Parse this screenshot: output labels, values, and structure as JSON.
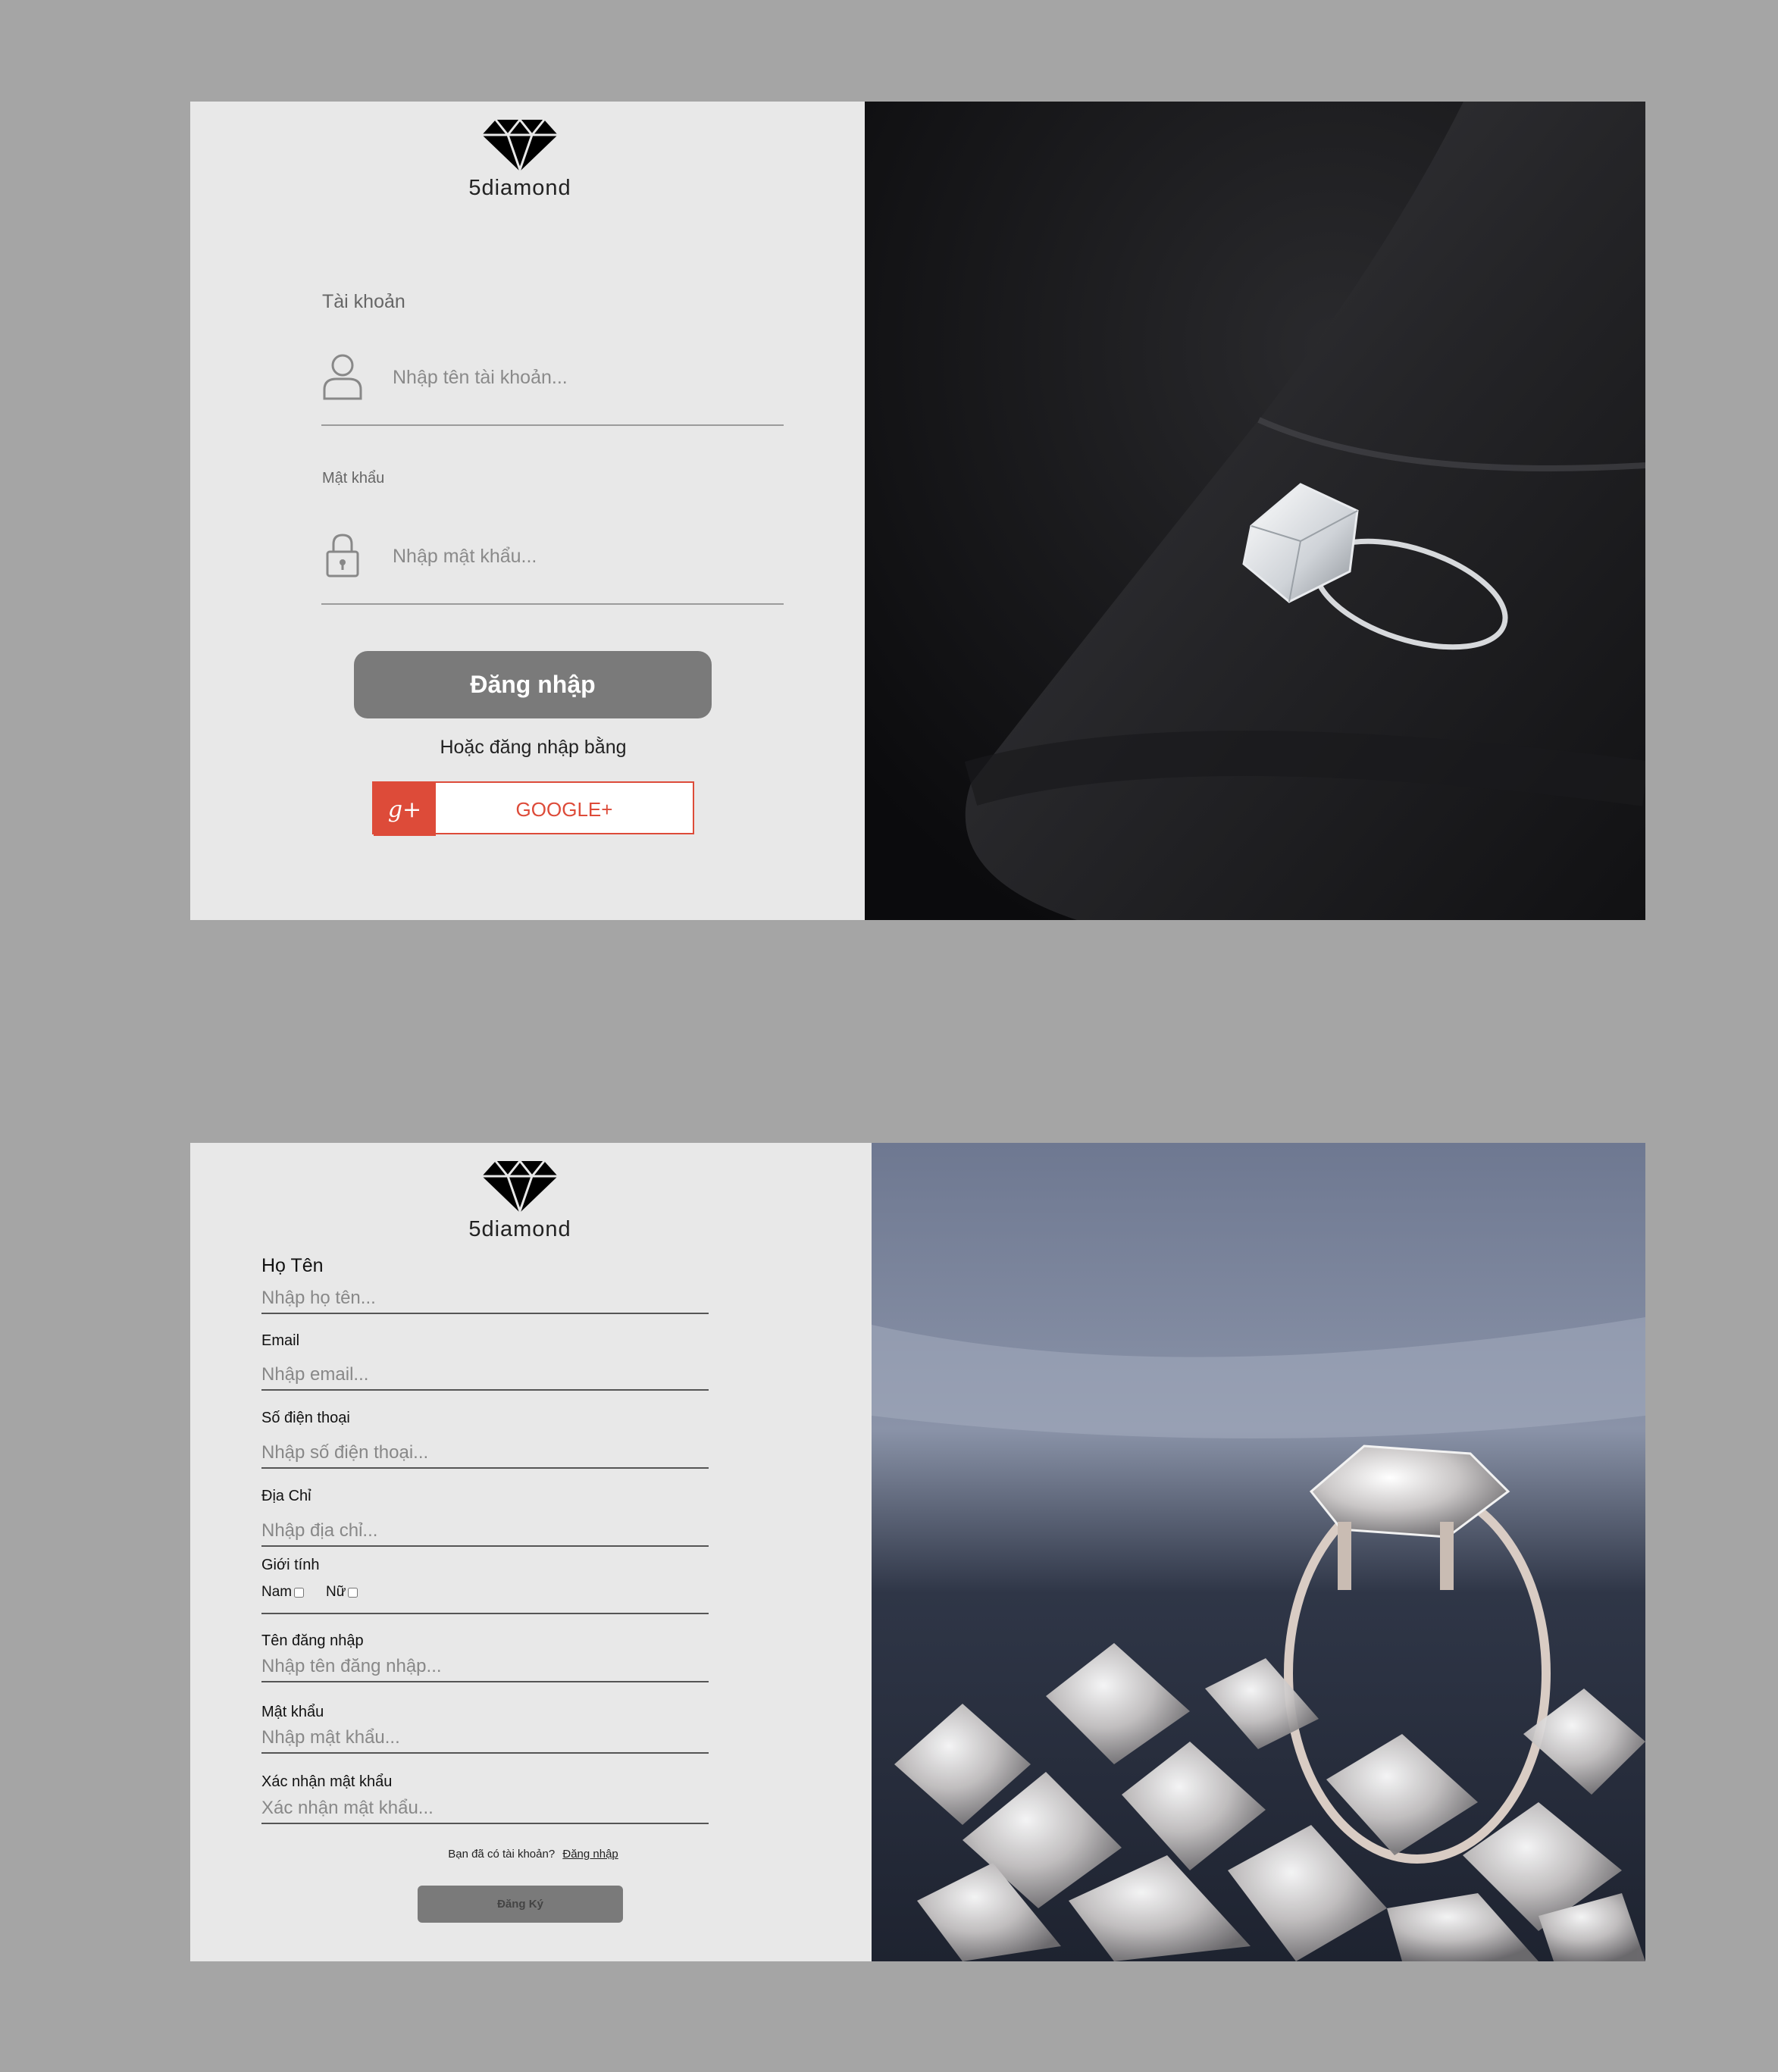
{
  "brand": {
    "name": "5diamond",
    "logo_icon": "diamond-icon"
  },
  "login": {
    "account_label": "Tài khoản",
    "account_placeholder": "Nhập tên tài khoản...",
    "password_label": "Mật khẩu",
    "password_placeholder": "Nhập mật khẩu...",
    "login_button": "Đăng nhập",
    "or_text": "Hoặc đăng nhập bằng",
    "google_button": "GOOGLE+",
    "google_icon": "g+",
    "google_color": "#dd4b39"
  },
  "register": {
    "fullname_label": "Họ Tên",
    "fullname_placeholder": "Nhập họ tên...",
    "email_label": "Email",
    "email_placeholder": "Nhập email...",
    "phone_label": "Số điện thoại",
    "phone_placeholder": "Nhập số điện thoại...",
    "address_label": "Địa Chỉ",
    "address_placeholder": "Nhập địa chỉ...",
    "gender_label": "Giới tính",
    "gender_male": "Nam",
    "gender_female": "Nữ",
    "username_label": "Tên đăng nhập",
    "username_placeholder": "Nhập tên đăng nhập...",
    "password_label": "Mật khẩu",
    "password_placeholder": "Nhập mật khẩu...",
    "confirm_label": "Xác nhận mật khẩu",
    "confirm_placeholder": "Xác nhận mật khẩu...",
    "have_account_text": "Bạn đã có tài khoản?",
    "login_link": "Đăng nhập",
    "register_button": "Đăng Ký"
  }
}
